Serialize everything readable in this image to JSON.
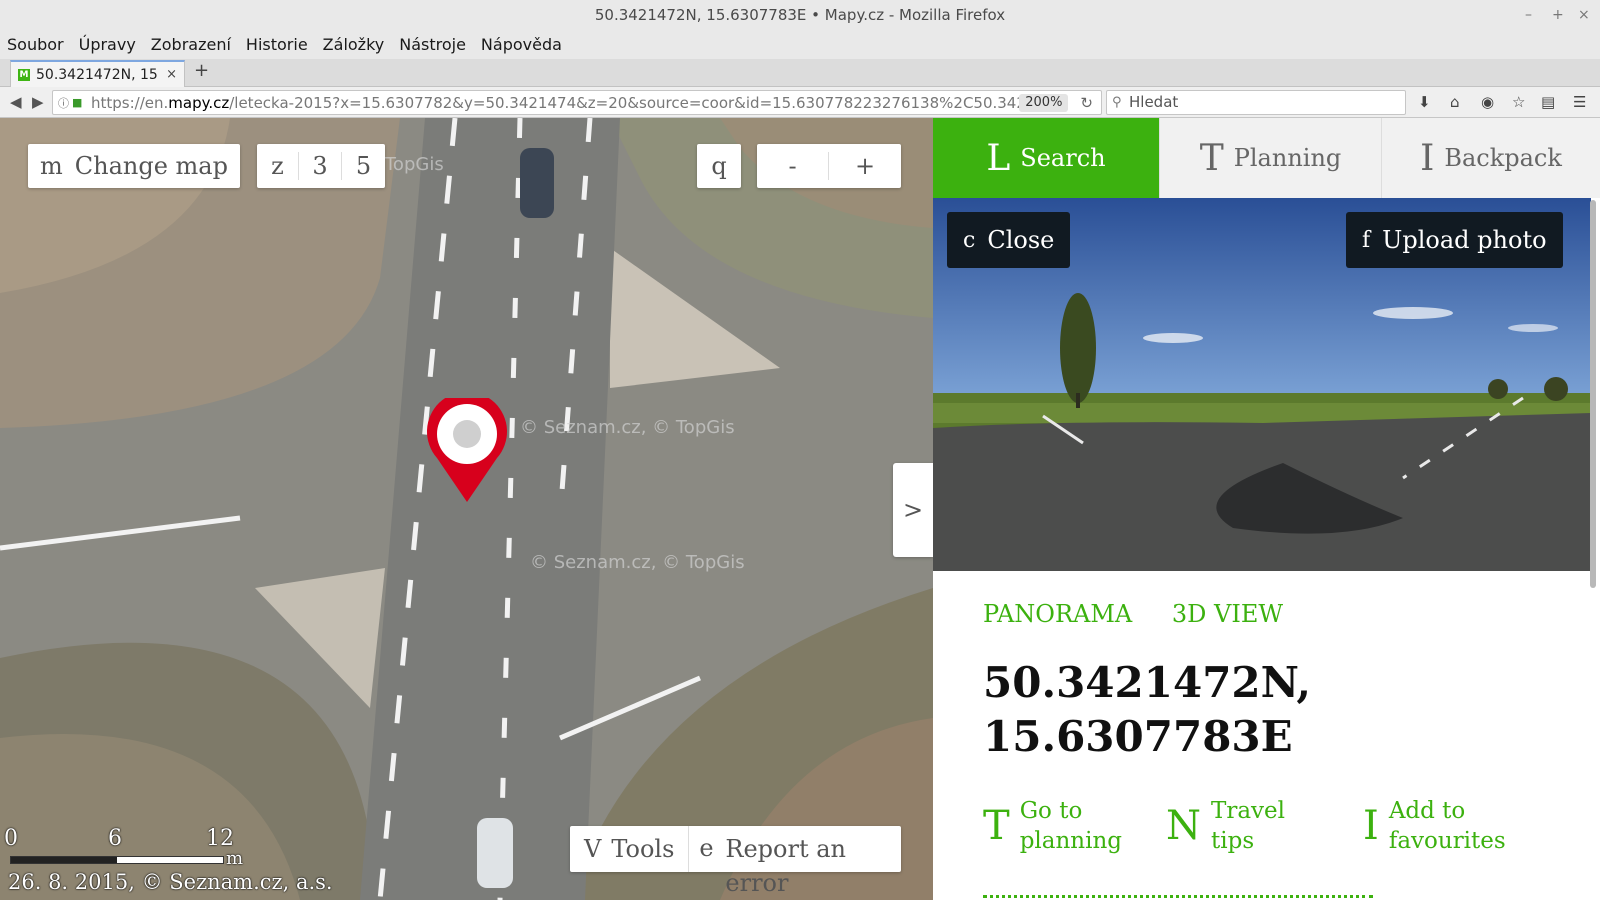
{
  "window": {
    "title": "50.3421472N, 15.6307783E • Mapy.cz - Mozilla Firefox",
    "minimize": "–",
    "maximize": "+",
    "close": "×"
  },
  "menu": [
    "Soubor",
    "Úpravy",
    "Zobrazení",
    "Historie",
    "Záložky",
    "Nástroje",
    "Nápověda"
  ],
  "tab": {
    "title": "50.3421472N, 15",
    "close": "×",
    "new": "+"
  },
  "nav": {
    "url_prefix": "https://en.",
    "url_domain": "mapy.cz",
    "url_path": "/letecka-2015?x=15.6307782&y=50.3421474&z=20&source=coor&id=15.630778223276138%2C50.342",
    "zoom": "200%",
    "search_placeholder": "Hledat"
  },
  "map": {
    "change_map": "Change map",
    "change_map_icon": "m",
    "view_buttons": [
      "z",
      "3",
      "5"
    ],
    "search_icon": "q",
    "zoom_out": "-",
    "zoom_in": "+",
    "expand": ">",
    "watermark": "© Seznam.cz, © TopGis",
    "watermark_top": "TopGis",
    "tools": "Tools",
    "tools_icon": "V",
    "report": "Report an error",
    "report_icon": "e",
    "scale_labels": [
      "0",
      "6",
      "12"
    ],
    "scale_unit": "m",
    "copyright": "26. 8. 2015, © Seznam.cz, a.s."
  },
  "panel": {
    "tabs": [
      {
        "icon": "L",
        "label": "Search",
        "active": true
      },
      {
        "icon": "T",
        "label": "Planning",
        "active": false
      },
      {
        "icon": "I",
        "label": "Backpack",
        "active": false
      }
    ],
    "close": "Close",
    "close_icon": "c",
    "upload": "Upload photo",
    "upload_icon": "f",
    "view_links": [
      "PANORAMA",
      "3D VIEW"
    ],
    "coord_lat": "50.3421472N,",
    "coord_lon": "15.6307783E",
    "actions": [
      {
        "icon": "T",
        "line1": "Go to",
        "line2": "planning"
      },
      {
        "icon": "N",
        "line1": "Travel",
        "line2": "tips"
      },
      {
        "icon": "I",
        "line1": "Add to",
        "line2": "favourites"
      }
    ]
  },
  "colors": {
    "accent": "#3cb10f",
    "dark_button": "#111a22",
    "marker": "#d7001c"
  }
}
